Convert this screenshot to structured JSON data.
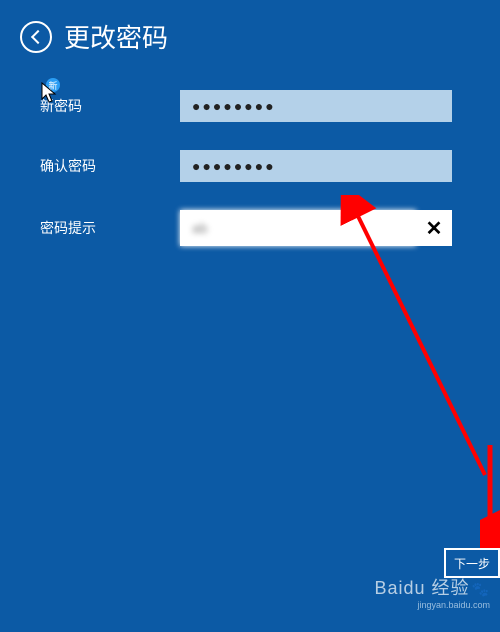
{
  "header": {
    "title": "更改密码"
  },
  "form": {
    "new_password_label": "新密码",
    "new_password_value": "●●●●●●●●",
    "confirm_password_label": "确认密码",
    "confirm_password_value": "●●●●●●●●",
    "hint_label": "密码提示",
    "hint_value": "ab",
    "clear_symbol": "✕"
  },
  "footer": {
    "next_button": "下一步"
  },
  "watermark": {
    "main": "Baidu 经验",
    "sub": "jingyan.baidu.com",
    "paw": "🐾"
  },
  "badge": {
    "text": "新"
  }
}
